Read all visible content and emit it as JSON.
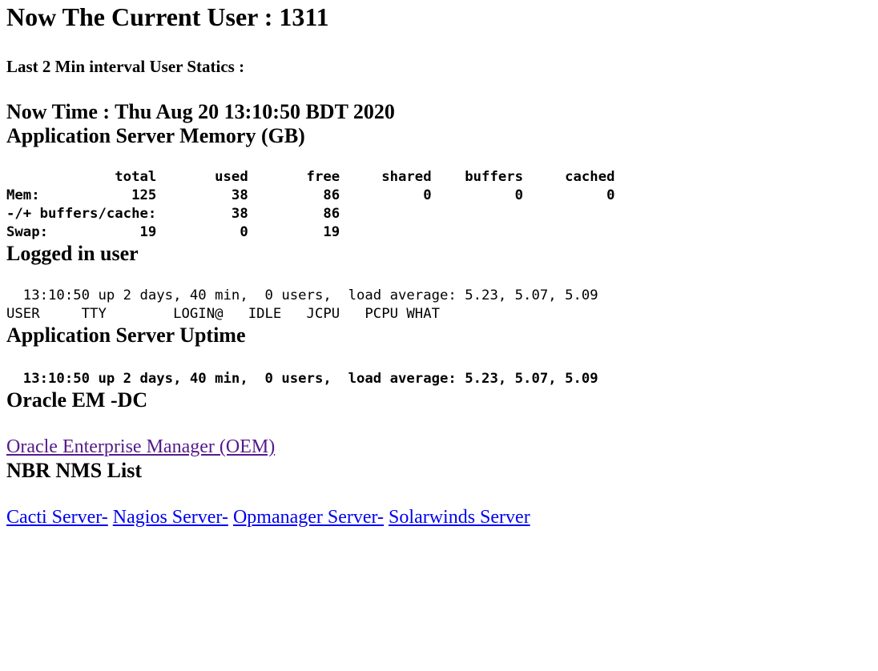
{
  "header": {
    "current_user_title": "Now The Current User : 1311",
    "interval_label": "Last 2 Min interval User Statics :",
    "now_time": "Now Time : Thu Aug 20 13:10:50 BDT 2020"
  },
  "memory": {
    "heading": "Application Server Memory (GB)",
    "header_row": "             total       used       free     shared    buffers     cached",
    "mem_row": "Mem:           125         38         86          0          0          0",
    "buffers_row": "-/+ buffers/cache:         38         86",
    "swap_row": "Swap:           19          0         19",
    "columns": [
      "total",
      "used",
      "free",
      "shared",
      "buffers",
      "cached"
    ],
    "rows": [
      {
        "label": "Mem:",
        "values": [
          "125",
          "38",
          "86",
          "0",
          "0",
          "0"
        ]
      },
      {
        "label": "-/+ buffers/cache:",
        "values": [
          "38",
          "86"
        ]
      },
      {
        "label": "Swap:",
        "values": [
          "19",
          "0",
          "19"
        ]
      }
    ]
  },
  "logged_in": {
    "heading": "Logged in user",
    "uptime_line": "  13:10:50 up 2 days, 40 min,  0 users,  load average: 5.23, 5.07, 5.09",
    "columns_line": "USER     TTY        LOGIN@   IDLE   JCPU   PCPU WHAT"
  },
  "uptime": {
    "heading": "Application Server Uptime",
    "uptime_line": "  13:10:50 up 2 days, 40 min,  0 users,  load average: 5.23, 5.07, 5.09"
  },
  "oracle": {
    "heading": "Oracle EM -DC",
    "link_label": "Oracle Enterprise Manager (OEM)",
    "link_color": "#551a8b"
  },
  "nms": {
    "heading": "NBR NMS List",
    "links": [
      {
        "label": "Cacti Server-"
      },
      {
        "label": "Nagios Server-"
      },
      {
        "label": "Opmanager Server-"
      },
      {
        "label": "Solarwinds Server"
      }
    ],
    "link_color": "#0000ee"
  }
}
